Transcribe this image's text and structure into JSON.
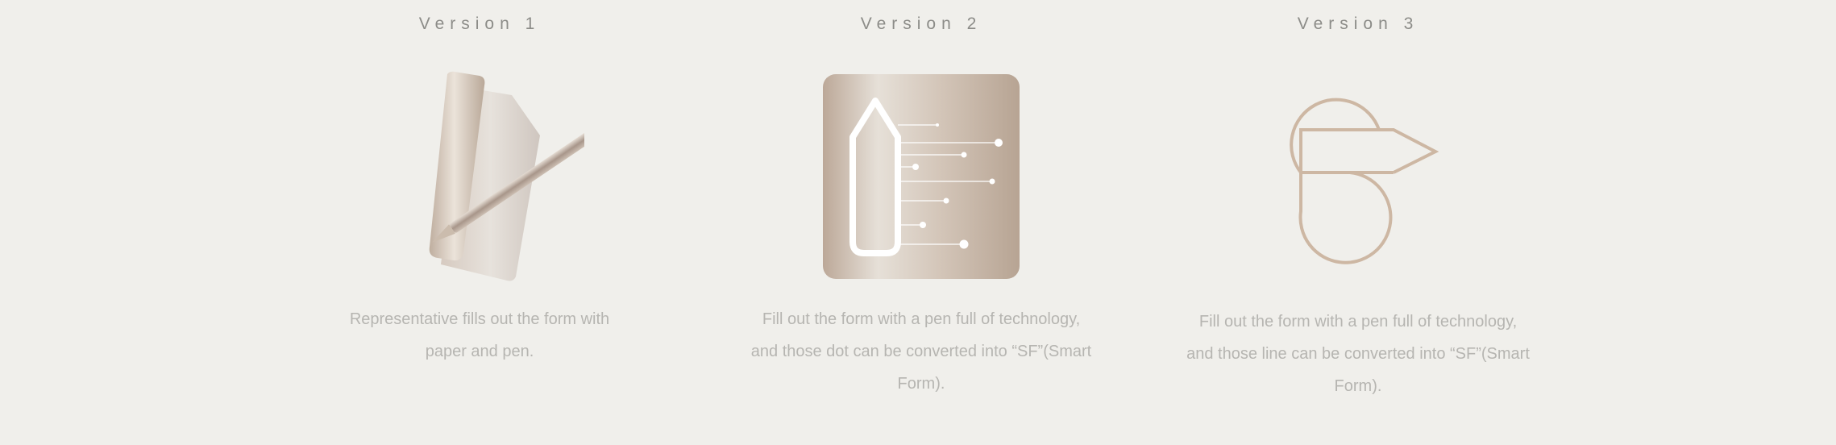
{
  "versions": [
    {
      "title": "Version 1",
      "icon": "paper-and-pen-icon",
      "lines": [
        "Representative fills out the form with",
        "paper and pen."
      ]
    },
    {
      "title": "Version 2",
      "icon": "tech-pen-icon",
      "lines": [
        "Fill out the form with a pen full of technology,",
        "and those dot can be converted into “SF”(Smart",
        "Form)."
      ]
    },
    {
      "title": "Version 3",
      "icon": "sf-line-logo-icon",
      "lines": [
        "Fill out the form with a pen full of technology,",
        "and those line can be converted into “SF”(Smart",
        "Form)."
      ]
    }
  ],
  "colors": {
    "background": "#f0efeb",
    "heading": "#8c8c88",
    "description": "#b6b5b1",
    "accent": "#c9b6a4"
  }
}
